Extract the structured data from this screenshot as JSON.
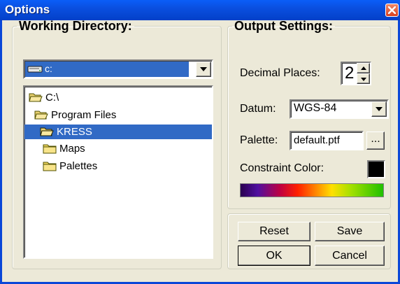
{
  "window": {
    "title": "Options"
  },
  "working_directory": {
    "legend": "Working Directory:",
    "drive": {
      "selected": "c:",
      "icon": "drive-icon"
    },
    "tree": [
      {
        "label": "C:\\",
        "icon": "open-folder-icon",
        "selected": false
      },
      {
        "label": "Program Files",
        "icon": "open-folder-icon",
        "selected": false
      },
      {
        "label": "KRESS",
        "icon": "open-folder-icon",
        "selected": true
      },
      {
        "label": "Maps",
        "icon": "folder-icon",
        "selected": false
      },
      {
        "label": "Palettes",
        "icon": "folder-icon",
        "selected": false
      }
    ]
  },
  "output_settings": {
    "legend": "Output Settings:",
    "decimal_places": {
      "label": "Decimal Places:",
      "value": "2"
    },
    "datum": {
      "label": "Datum:",
      "value": "WGS-84"
    },
    "palette": {
      "label": "Palette:",
      "value": "default.ptf",
      "browse_label": "..."
    },
    "constraint_color": {
      "label": "Constraint Color:",
      "color": "#000000"
    },
    "gradient_colors": [
      "#2a0050",
      "#5010a0",
      "#c00040",
      "#ff2000",
      "#ff8000",
      "#ffe000",
      "#a0e000",
      "#20c000"
    ]
  },
  "buttons": {
    "reset": "Reset",
    "save": "Save",
    "ok": "OK",
    "cancel": "Cancel"
  },
  "colors": {
    "title_bar": "#0a4fe0",
    "dialog_bg": "#ece9d8",
    "selection": "#316ac5",
    "close_button": "#d84020"
  }
}
